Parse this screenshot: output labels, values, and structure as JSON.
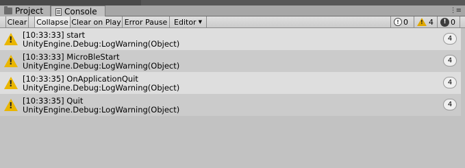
{
  "tabs": {
    "project_label": "Project",
    "console_label": "Console"
  },
  "toolbar": {
    "clear_label": "Clear",
    "collapse_label": "Collapse",
    "clear_on_play_label": "Clear on Play",
    "error_pause_label": "Error Pause",
    "editor_label": "Editor"
  },
  "counters": {
    "info_count": "0",
    "warning_count": "4",
    "error_count": "0"
  },
  "colors": {
    "warning": "#eab600",
    "row_light": "#dedede",
    "row_dark": "#cbcbcb"
  },
  "logs": [
    {
      "message": "[10:33:33] start",
      "source": "UnityEngine.Debug:LogWarning(Object)",
      "count": "4",
      "icon": "warning-icon"
    },
    {
      "message": "[10:33:33] MicroBleStart",
      "source": "UnityEngine.Debug:LogWarning(Object)",
      "count": "4",
      "icon": "warning-icon"
    },
    {
      "message": "[10:33:35] OnApplicationQuit",
      "source": "UnityEngine.Debug:LogWarning(Object)",
      "count": "4",
      "icon": "warning-icon"
    },
    {
      "message": "[10:33:35] Quit",
      "source": "UnityEngine.Debug:LogWarning(Object)",
      "count": "4",
      "icon": "warning-icon"
    }
  ]
}
